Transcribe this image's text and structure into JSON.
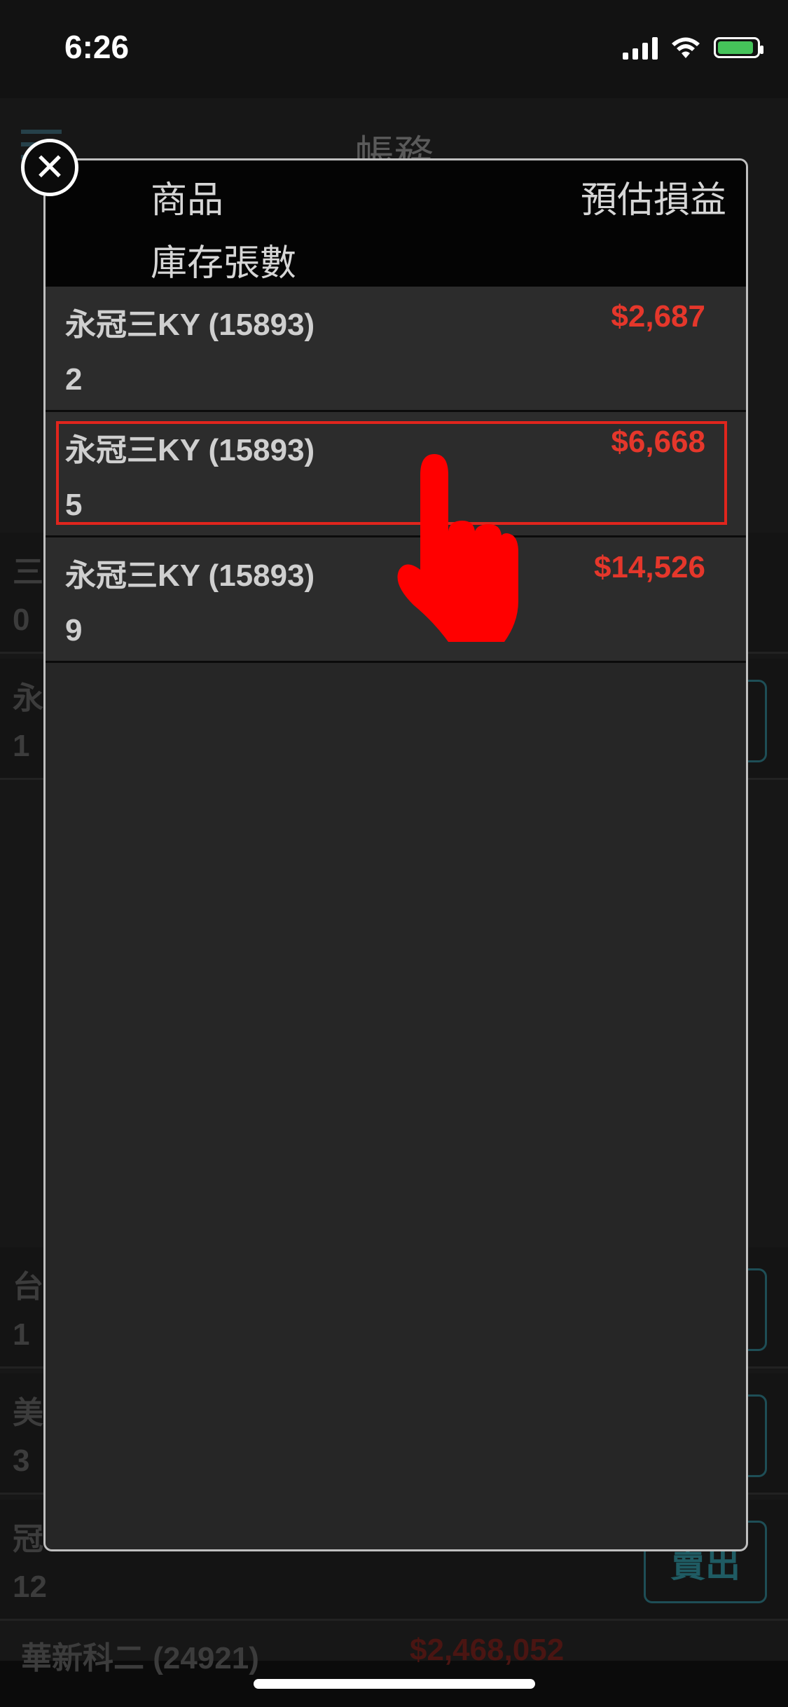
{
  "status": {
    "time": "6:26"
  },
  "background": {
    "title": "帳務",
    "rows": [
      {
        "left": "三",
        "subleft": "0"
      },
      {
        "left": "永",
        "subleft": "1"
      },
      {
        "left": "台",
        "subleft": "1"
      },
      {
        "left": "美",
        "subleft": "3"
      },
      {
        "left": "冠",
        "subleft": "12"
      }
    ],
    "sell_label": "賣出",
    "partial_bottom": "華新科二 (24921)",
    "partial_bottom_value": "$2,468,052"
  },
  "modal": {
    "header": {
      "product_label": "商品",
      "pnl_label": "預估損益",
      "qty_label": "庫存張數"
    },
    "rows": [
      {
        "name": "永冠三KY (15893)",
        "pnl": "$2,687",
        "qty": "2"
      },
      {
        "name": "永冠三KY (15893)",
        "pnl": "$6,668",
        "qty": "5"
      },
      {
        "name": "永冠三KY (15893)",
        "pnl": "$14,526",
        "qty": "9"
      }
    ],
    "close_symbol": "✕"
  },
  "colors": {
    "accent_red": "#e5372b",
    "highlight_red": "#e0251d",
    "background": "#0b0b0b",
    "modal_bg": "#262626"
  }
}
